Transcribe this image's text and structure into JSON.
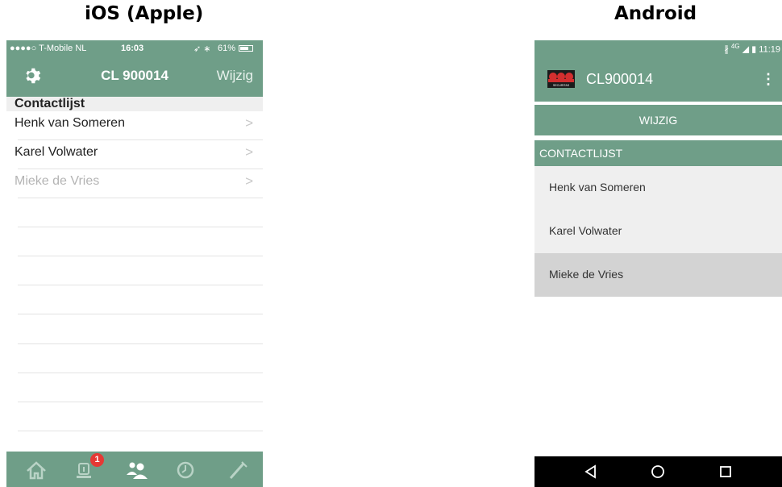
{
  "headings": {
    "ios": "iOS (Apple)",
    "android": "Android"
  },
  "ios": {
    "status": {
      "carrier": "●●●●○ T-Mobile NL",
      "time": "16:03",
      "battery": "61%"
    },
    "nav": {
      "title": "CL 900014",
      "edit_label": "Wijzig",
      "settings_icon": "gear-icon"
    },
    "section_title": "Contactlijst",
    "contacts": [
      {
        "name": "Henk van Someren",
        "dimmed": false
      },
      {
        "name": "Karel Volwater",
        "dimmed": false
      },
      {
        "name": "Mieke de Vries",
        "dimmed": true
      }
    ],
    "chevron": ">",
    "tabbar": {
      "tabs": [
        "home-icon",
        "alarm-icon",
        "contacts-icon",
        "history-icon",
        "tools-icon"
      ],
      "badge": "1",
      "active_tab": "contacts-icon"
    }
  },
  "android": {
    "status": {
      "network": "4G",
      "time": "11:19"
    },
    "toolbar": {
      "title": "CL900014",
      "logo": "securitas-logo",
      "logo_text": "SECURITAS",
      "overflow": "⋮"
    },
    "wijzig_label": "WIJZIG",
    "section_title": "CONTACTLIJST",
    "contacts": [
      {
        "name": "Henk van Someren",
        "selected": false
      },
      {
        "name": "Karel Volwater",
        "selected": false
      },
      {
        "name": "Mieke de Vries",
        "selected": true
      }
    ],
    "navbar": [
      "back-icon",
      "home-icon",
      "recents-icon"
    ]
  },
  "colors": {
    "brand_green": "#6f9e88",
    "badge_red": "#e53935",
    "securitas_red": "#d32f2f"
  }
}
